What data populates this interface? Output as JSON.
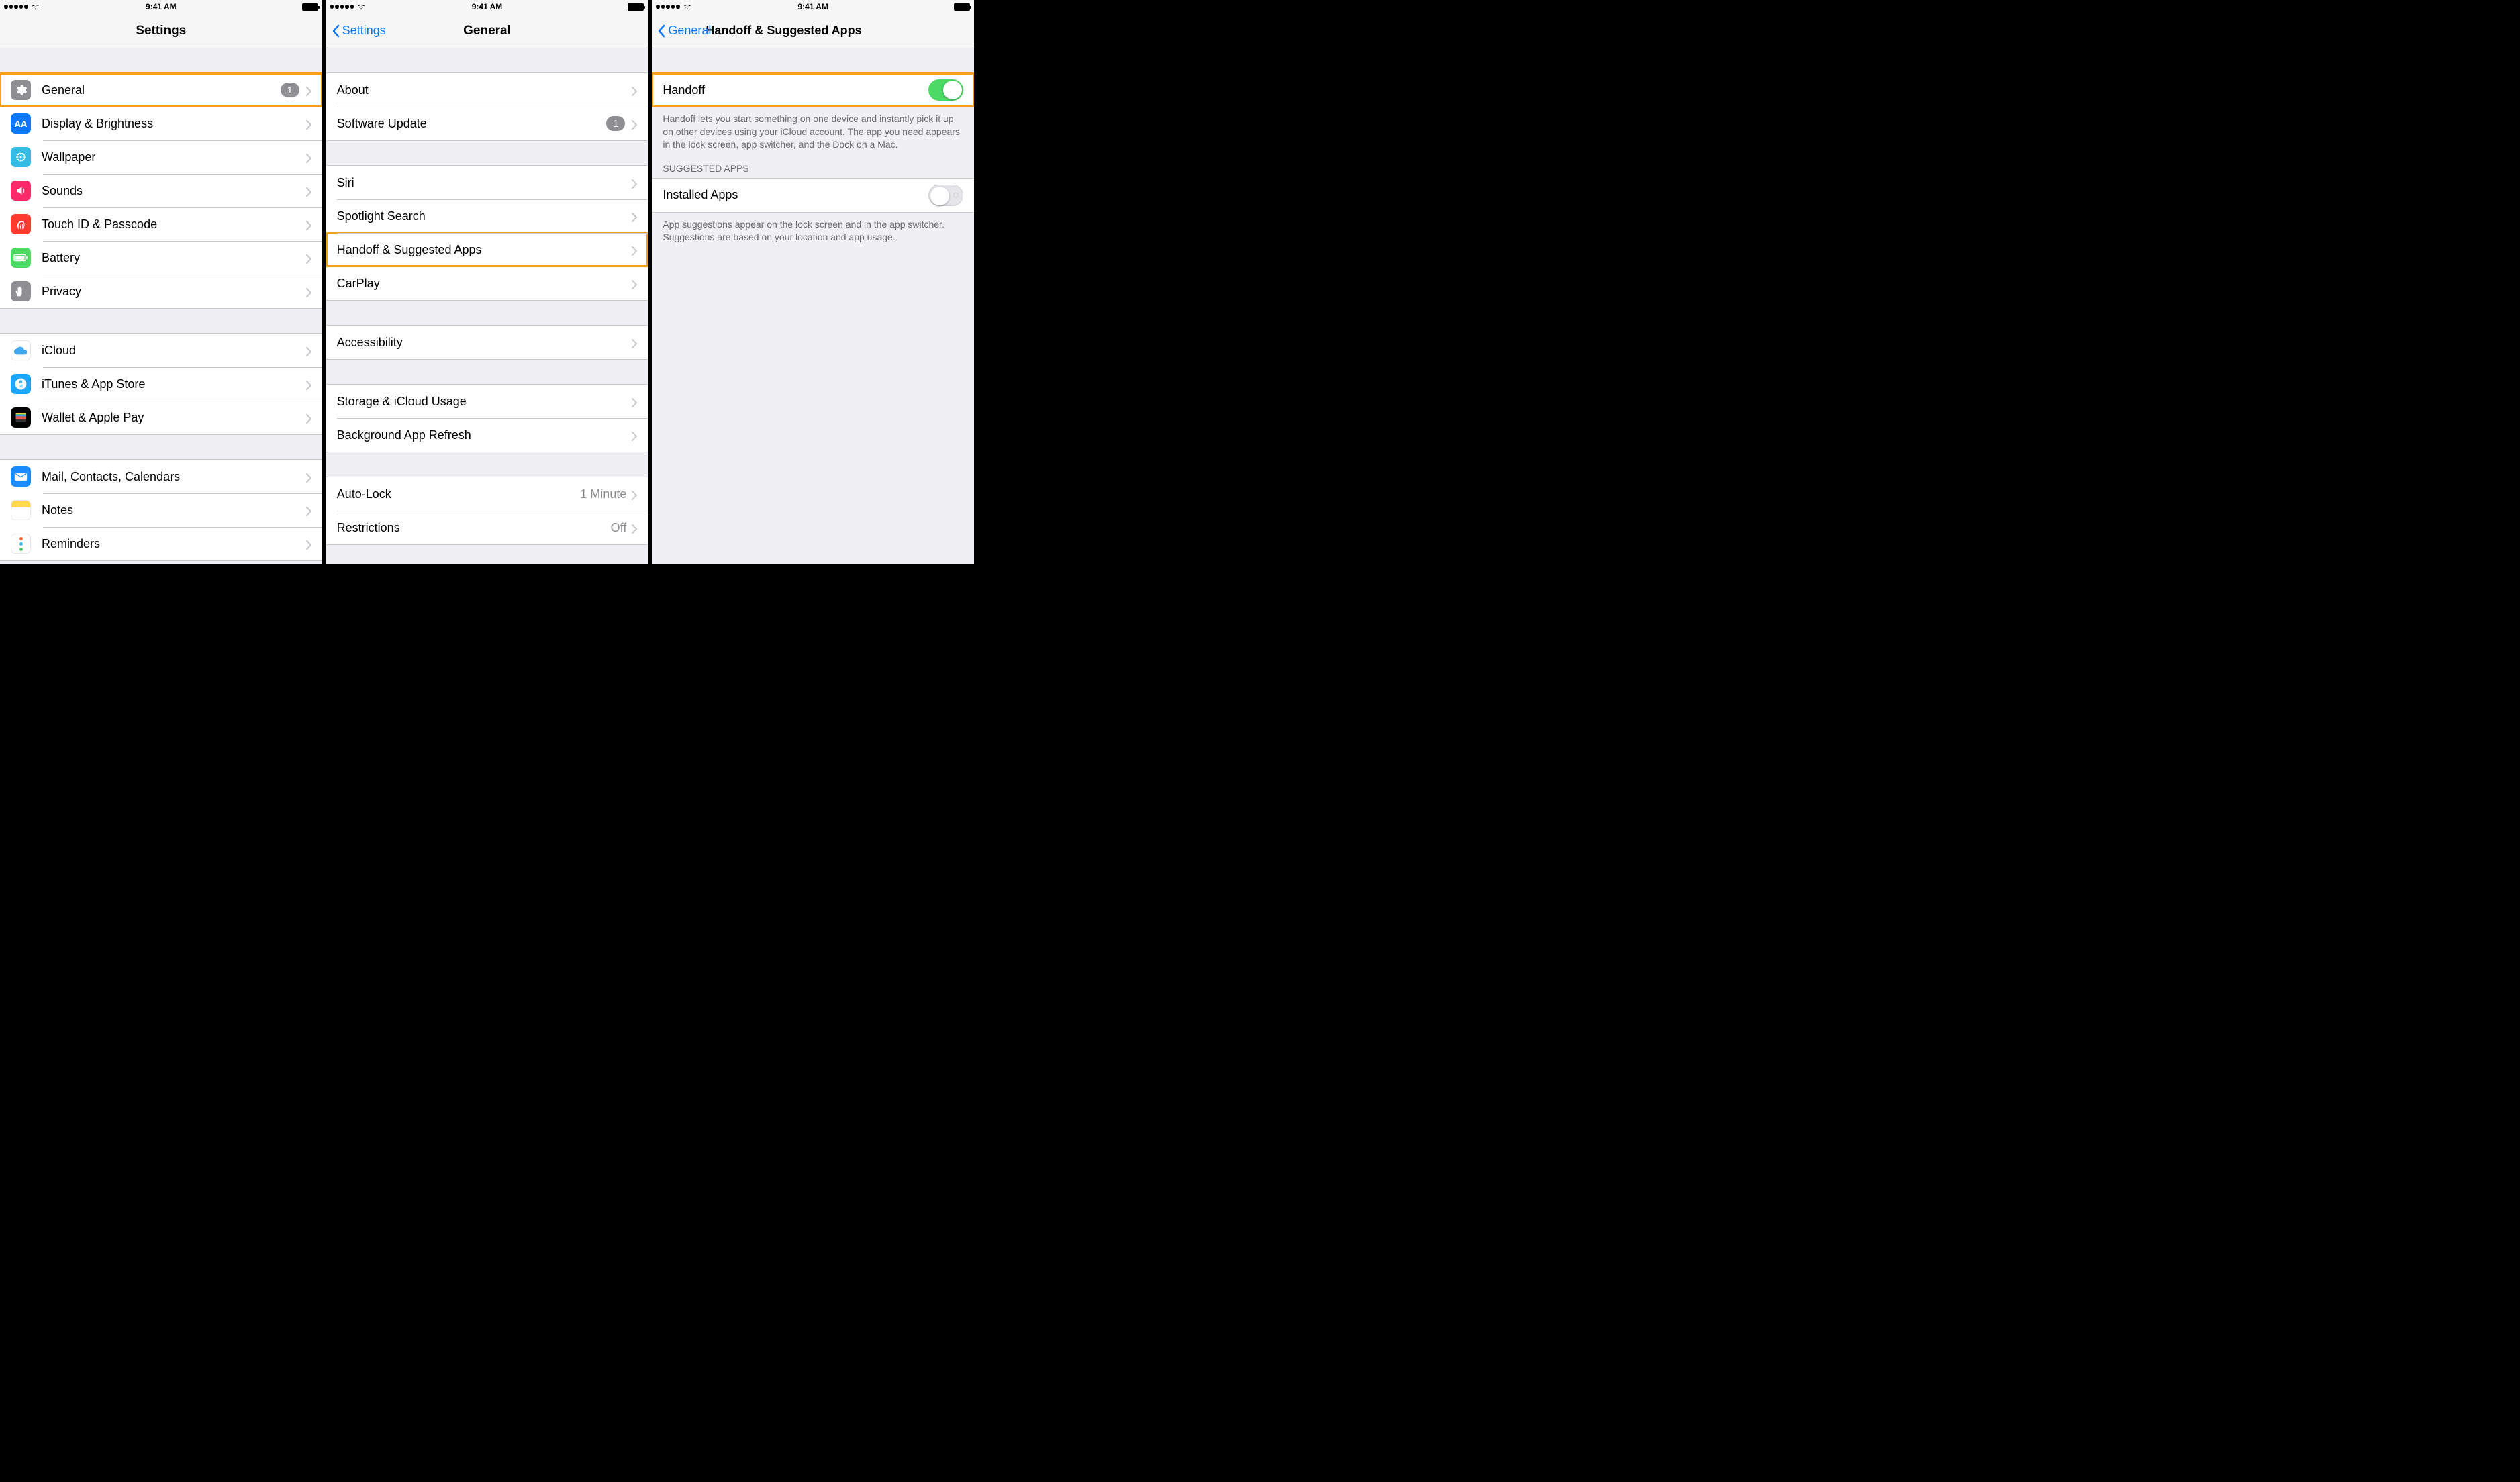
{
  "status": {
    "time": "9:41 AM"
  },
  "screens": {
    "settings": {
      "title": "Settings",
      "groups": [
        [
          {
            "key": "general",
            "label": "General",
            "badge": "1"
          },
          {
            "key": "display",
            "label": "Display & Brightness"
          },
          {
            "key": "wallpaper",
            "label": "Wallpaper"
          },
          {
            "key": "sounds",
            "label": "Sounds"
          },
          {
            "key": "touchid",
            "label": "Touch ID & Passcode"
          },
          {
            "key": "battery",
            "label": "Battery"
          },
          {
            "key": "privacy",
            "label": "Privacy"
          }
        ],
        [
          {
            "key": "icloud",
            "label": "iCloud"
          },
          {
            "key": "itunes",
            "label": "iTunes & App Store"
          },
          {
            "key": "wallet",
            "label": "Wallet & Apple Pay"
          }
        ],
        [
          {
            "key": "mail",
            "label": "Mail, Contacts, Calendars"
          },
          {
            "key": "notes",
            "label": "Notes"
          },
          {
            "key": "reminders",
            "label": "Reminders"
          }
        ]
      ]
    },
    "general": {
      "back": "Settings",
      "title": "General",
      "groups": [
        [
          {
            "key": "about",
            "label": "About"
          },
          {
            "key": "swupd",
            "label": "Software Update",
            "badge": "1"
          }
        ],
        [
          {
            "key": "siri",
            "label": "Siri"
          },
          {
            "key": "spotlight",
            "label": "Spotlight Search"
          },
          {
            "key": "handoff",
            "label": "Handoff & Suggested Apps"
          },
          {
            "key": "carplay",
            "label": "CarPlay"
          }
        ],
        [
          {
            "key": "accessibility",
            "label": "Accessibility"
          }
        ],
        [
          {
            "key": "storage",
            "label": "Storage & iCloud Usage"
          },
          {
            "key": "bgapp",
            "label": "Background App Refresh"
          }
        ],
        [
          {
            "key": "autolock",
            "label": "Auto-Lock",
            "detail": "1 Minute"
          },
          {
            "key": "restrictions",
            "label": "Restrictions",
            "detail": "Off"
          }
        ]
      ]
    },
    "handoff": {
      "back": "General",
      "title": "Handoff & Suggested Apps",
      "handoff_label": "Handoff",
      "handoff_on": true,
      "handoff_footer": "Handoff lets you start something on one device and instantly pick it up on other devices using your iCloud account. The app you need appears in the lock screen, app switcher, and the Dock on a Mac.",
      "suggested_header": "SUGGESTED APPS",
      "installed_label": "Installed Apps",
      "installed_on": false,
      "suggested_footer": "App suggestions appear on the lock screen and in the app switcher. Suggestions are based on your location and app usage."
    }
  }
}
